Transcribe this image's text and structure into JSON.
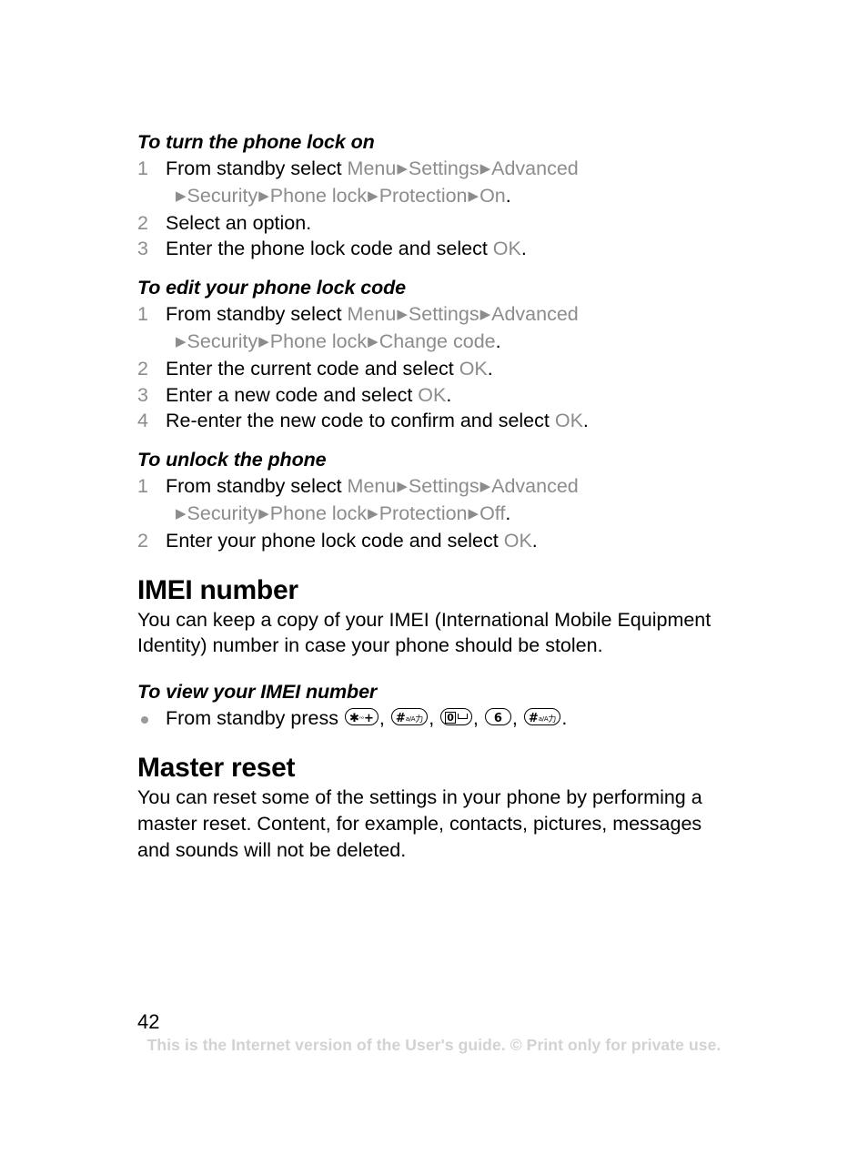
{
  "document": {
    "page_number": "42",
    "footer_note": "This is the Internet version of the User's guide. © Print only for private use."
  },
  "colors": {
    "text": "#000000",
    "menu_gray": "#8c8c8c",
    "footer_gray": "#d2d2d2"
  },
  "procedures": [
    {
      "title": "To turn the phone lock on",
      "steps": [
        {
          "num": "1",
          "parts": [
            {
              "type": "text",
              "value": "From standby select "
            },
            {
              "type": "menu",
              "value": "Menu"
            },
            {
              "type": "arrow",
              "value": "▶"
            },
            {
              "type": "menu",
              "value": "Settings"
            },
            {
              "type": "arrow",
              "value": "▶"
            },
            {
              "type": "menu",
              "value": "Advanced"
            },
            {
              "type": "break"
            },
            {
              "type": "arrow",
              "value": "▶"
            },
            {
              "type": "menu",
              "value": "Security"
            },
            {
              "type": "arrow",
              "value": "▶"
            },
            {
              "type": "menu",
              "value": "Phone lock"
            },
            {
              "type": "arrow",
              "value": "▶"
            },
            {
              "type": "menu",
              "value": "Protection"
            },
            {
              "type": "arrow",
              "value": "▶"
            },
            {
              "type": "menu",
              "value": "On"
            },
            {
              "type": "text",
              "value": "."
            }
          ]
        },
        {
          "num": "2",
          "parts": [
            {
              "type": "text",
              "value": "Select an option."
            }
          ]
        },
        {
          "num": "3",
          "parts": [
            {
              "type": "text",
              "value": "Enter the phone lock code and select "
            },
            {
              "type": "menu",
              "value": "OK"
            },
            {
              "type": "text",
              "value": "."
            }
          ]
        }
      ]
    },
    {
      "title": "To edit your phone lock code",
      "steps": [
        {
          "num": "1",
          "parts": [
            {
              "type": "text",
              "value": "From standby select "
            },
            {
              "type": "menu",
              "value": "Menu"
            },
            {
              "type": "arrow",
              "value": "▶"
            },
            {
              "type": "menu",
              "value": "Settings"
            },
            {
              "type": "arrow",
              "value": "▶"
            },
            {
              "type": "menu",
              "value": "Advanced"
            },
            {
              "type": "break"
            },
            {
              "type": "arrow",
              "value": "▶"
            },
            {
              "type": "menu",
              "value": "Security"
            },
            {
              "type": "arrow",
              "value": "▶"
            },
            {
              "type": "menu",
              "value": "Phone lock"
            },
            {
              "type": "arrow",
              "value": "▶"
            },
            {
              "type": "menu",
              "value": "Change code"
            },
            {
              "type": "text",
              "value": "."
            }
          ]
        },
        {
          "num": "2",
          "parts": [
            {
              "type": "text",
              "value": "Enter the current code and select "
            },
            {
              "type": "menu",
              "value": "OK"
            },
            {
              "type": "text",
              "value": "."
            }
          ]
        },
        {
          "num": "3",
          "parts": [
            {
              "type": "text",
              "value": "Enter a new code and select "
            },
            {
              "type": "menu",
              "value": "OK"
            },
            {
              "type": "text",
              "value": "."
            }
          ]
        },
        {
          "num": "4",
          "parts": [
            {
              "type": "text",
              "value": "Re-enter the new code to confirm and select "
            },
            {
              "type": "menu",
              "value": "OK"
            },
            {
              "type": "text",
              "value": "."
            }
          ]
        }
      ]
    },
    {
      "title": "To unlock the phone",
      "steps": [
        {
          "num": "1",
          "parts": [
            {
              "type": "text",
              "value": "From standby select "
            },
            {
              "type": "menu",
              "value": "Menu"
            },
            {
              "type": "arrow",
              "value": "▶"
            },
            {
              "type": "menu",
              "value": "Settings"
            },
            {
              "type": "arrow",
              "value": "▶"
            },
            {
              "type": "menu",
              "value": "Advanced"
            },
            {
              "type": "break"
            },
            {
              "type": "arrow",
              "value": "▶"
            },
            {
              "type": "menu",
              "value": "Security"
            },
            {
              "type": "arrow",
              "value": "▶"
            },
            {
              "type": "menu",
              "value": "Phone lock"
            },
            {
              "type": "arrow",
              "value": "▶"
            },
            {
              "type": "menu",
              "value": "Protection"
            },
            {
              "type": "arrow",
              "value": "▶"
            },
            {
              "type": "menu",
              "value": "Off"
            },
            {
              "type": "text",
              "value": "."
            }
          ]
        },
        {
          "num": "2",
          "parts": [
            {
              "type": "text",
              "value": "Enter your phone lock code and select "
            },
            {
              "type": "menu",
              "value": "OK"
            },
            {
              "type": "text",
              "value": "."
            }
          ]
        }
      ]
    }
  ],
  "sections": [
    {
      "heading": "IMEI number",
      "body": "You can keep a copy of your IMEI (International Mobile Equipment Identity) number in case your phone should be stolen."
    },
    {
      "heading": "Master reset",
      "body": "You can reset some of the settings in your phone by performing a master reset. Content, for example, contacts, pictures, messages and sounds will not be deleted."
    }
  ],
  "imei_procedure": {
    "title": "To view your IMEI number",
    "lead_text": "From standby press ",
    "keys": [
      {
        "name": "star-key",
        "big": "✱",
        "tiny": "ⁿᵒ",
        "plus": "+"
      },
      {
        "name": "hash-key",
        "big": "#",
        "tiny": "a/A",
        "cjk": "力"
      },
      {
        "name": "zero-key",
        "boxed": "0",
        "spacebar": true
      },
      {
        "name": "six-key",
        "big": "6"
      },
      {
        "name": "hash-key-2",
        "big": "#",
        "tiny": "a/A",
        "cjk": "力"
      }
    ],
    "separator": ", ",
    "terminator": "."
  }
}
